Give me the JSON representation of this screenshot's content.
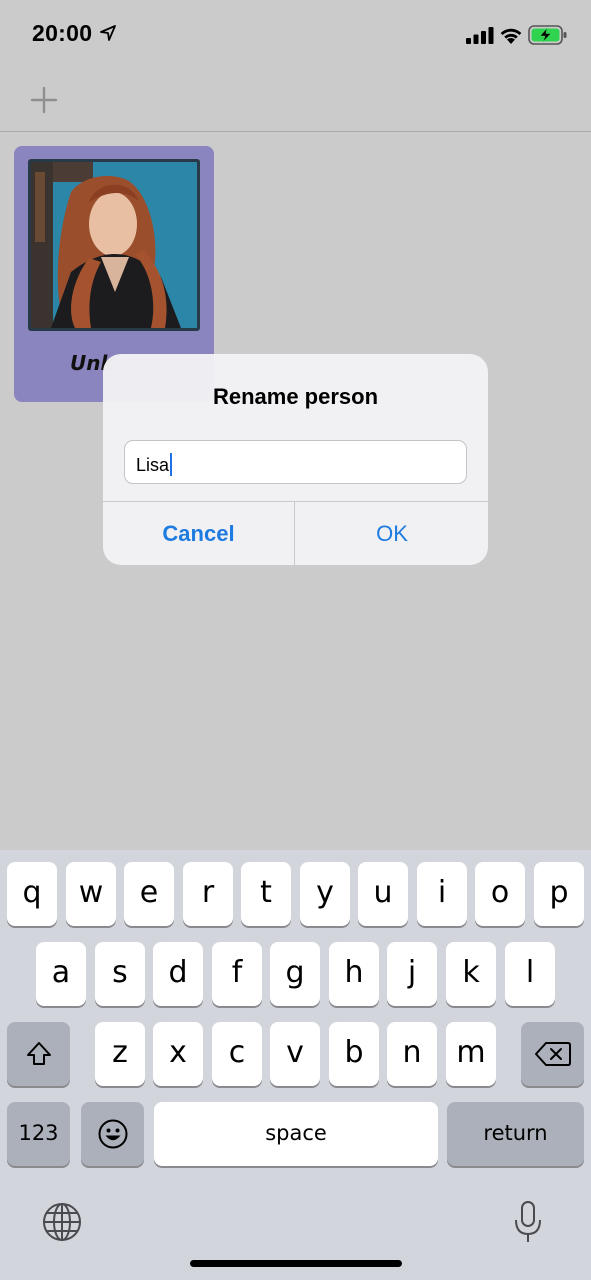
{
  "status_bar": {
    "time": "20:00"
  },
  "person_card": {
    "label": "Unk"
  },
  "dialog": {
    "title": "Rename person",
    "input_value": "Lisa",
    "cancel_label": "Cancel",
    "ok_label": "OK"
  },
  "keyboard": {
    "row1": [
      "q",
      "w",
      "e",
      "r",
      "t",
      "y",
      "u",
      "i",
      "o",
      "p"
    ],
    "row2": [
      "a",
      "s",
      "d",
      "f",
      "g",
      "h",
      "j",
      "k",
      "l"
    ],
    "row3": [
      "z",
      "x",
      "c",
      "v",
      "b",
      "n",
      "m"
    ],
    "numbers_label": "123",
    "space_label": "space",
    "return_label": "return"
  },
  "colors": {
    "accent": "#1e7be0",
    "card_background": "#8a85bf",
    "background": "#cbcbcb",
    "battery": "#2fd34f"
  },
  "icons": [
    "location-arrow-icon",
    "signal-icon",
    "wifi-icon",
    "battery-charging-icon",
    "plus-icon",
    "shift-icon",
    "backspace-icon",
    "emoji-icon",
    "globe-icon",
    "microphone-icon"
  ]
}
